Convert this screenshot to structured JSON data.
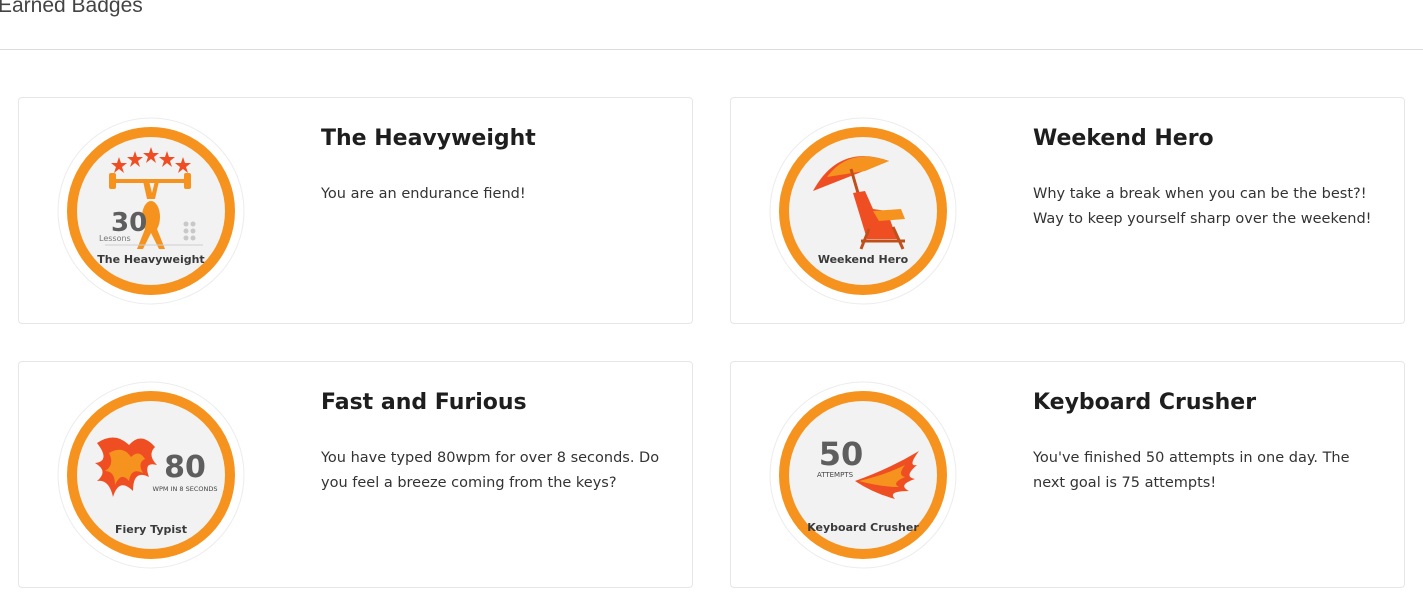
{
  "header": {
    "title": "Earned Badges"
  },
  "accent": "#f5931e",
  "badges": [
    {
      "title": "The Heavyweight",
      "description": "You are an endurance fiend!",
      "icon": "heavyweight-badge-icon",
      "art": {
        "number": "30",
        "sub": "Lessons",
        "caption": "The Heavyweight"
      }
    },
    {
      "title": "Weekend Hero",
      "description": "Why take a break when you can be the best?! Way to keep yourself sharp over the weekend!",
      "icon": "weekend-hero-badge-icon",
      "art": {
        "caption": "Weekend Hero"
      }
    },
    {
      "title": "Fast and Furious",
      "description": "You have typed 80wpm for over 8 seconds. Do you feel a breeze coming from the keys?",
      "icon": "fiery-typist-badge-icon",
      "art": {
        "number": "80",
        "sub": "WPM IN 8 SECONDS",
        "caption": "Fiery Typist"
      }
    },
    {
      "title": "Keyboard Crusher",
      "description": "You've finished 50 attempts in one day. The next goal is 75 attempts!",
      "icon": "keyboard-crusher-badge-icon",
      "art": {
        "number": "50",
        "sub": "ATTEMPTS",
        "caption": "Keyboard Crusher"
      }
    }
  ]
}
